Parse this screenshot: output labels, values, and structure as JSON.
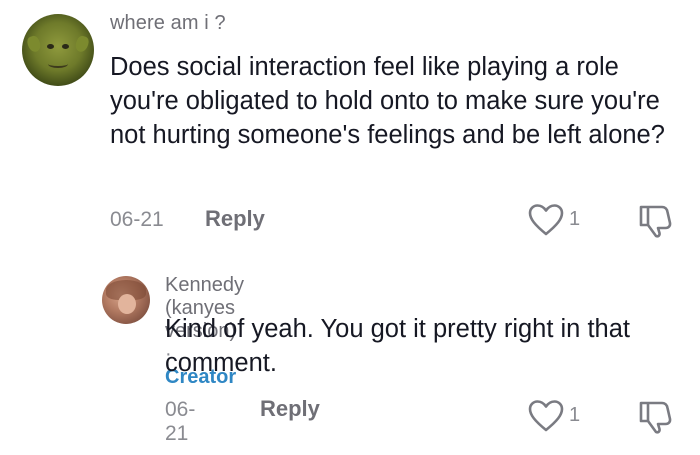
{
  "comments": [
    {
      "username": "where am i ?",
      "text": "Does social interaction feel like playing a role you're obligated to hold onto to make sure you're not hurting someone's feelings and be left alone?",
      "date": "06-21",
      "reply_label": "Reply",
      "like_count": "1",
      "avatar_icon": "shrek-avatar"
    }
  ],
  "replies": [
    {
      "username": "Kennedy (kanyes version)",
      "separator": "·",
      "creator_badge": "Creator",
      "text": "Kind of yeah. You got it pretty right in that comment.",
      "date": "06-21",
      "reply_label": "Reply",
      "like_count": "1",
      "avatar_icon": "user-photo-avatar"
    }
  ],
  "colors": {
    "text_primary": "#161823",
    "text_secondary": "#6f6f76",
    "creator_accent": "#2f87c4"
  }
}
